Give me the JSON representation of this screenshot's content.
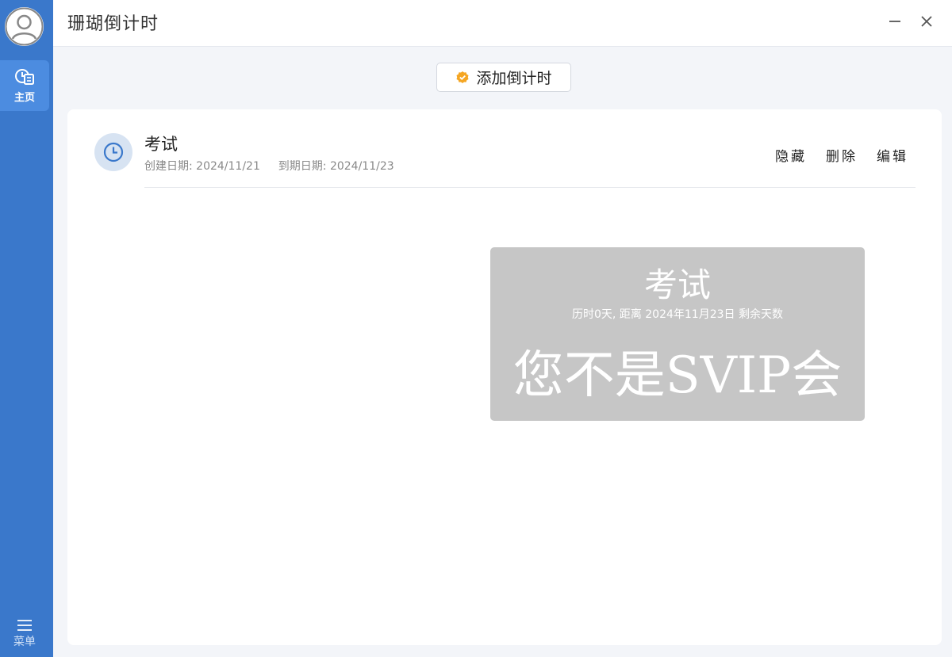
{
  "app": {
    "title": "珊瑚倒计时"
  },
  "sidebar": {
    "home_label": "主页",
    "menu_label": "菜单"
  },
  "toolbar": {
    "add_label": "添加倒计时",
    "add_icon_color": "#f5a623"
  },
  "countdown": {
    "title": "考试",
    "created_label": "创建日期:",
    "created_date": "2024/11/21",
    "due_label": "到期日期:",
    "due_date": "2024/11/23",
    "actions": {
      "hide": "隐藏",
      "delete": "删除",
      "edit": "编辑"
    }
  },
  "preview": {
    "title": "考试",
    "subtitle": "历时0天, 距离 2024年11月23日 剩余天数",
    "message": "您不是SVIP会员"
  },
  "colors": {
    "sidebar": "#3a78cb",
    "sidebar_active": "#4c8ce0",
    "preview_bg": "#c6c6c6"
  }
}
